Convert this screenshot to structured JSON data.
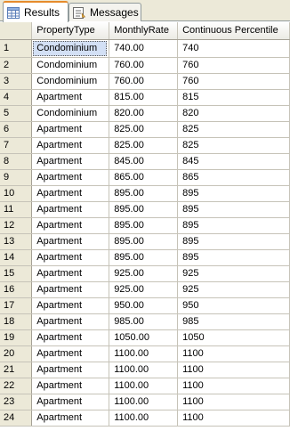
{
  "tabs": [
    {
      "label": "Results",
      "icon": "grid-icon"
    },
    {
      "label": "Messages",
      "icon": "messages-icon"
    }
  ],
  "columns": [
    "",
    "PropertyType",
    "MonthlyRate",
    "Continuous Percentile"
  ],
  "rows": [
    {
      "n": "1",
      "type": "Condominium",
      "rate": "740.00",
      "pct": "740"
    },
    {
      "n": "2",
      "type": "Condominium",
      "rate": "760.00",
      "pct": "760"
    },
    {
      "n": "3",
      "type": "Condominium",
      "rate": "760.00",
      "pct": "760"
    },
    {
      "n": "4",
      "type": "Apartment",
      "rate": "815.00",
      "pct": "815"
    },
    {
      "n": "5",
      "type": "Condominium",
      "rate": "820.00",
      "pct": "820"
    },
    {
      "n": "6",
      "type": "Apartment",
      "rate": "825.00",
      "pct": "825"
    },
    {
      "n": "7",
      "type": "Apartment",
      "rate": "825.00",
      "pct": "825"
    },
    {
      "n": "8",
      "type": "Apartment",
      "rate": "845.00",
      "pct": "845"
    },
    {
      "n": "9",
      "type": "Apartment",
      "rate": "865.00",
      "pct": "865"
    },
    {
      "n": "10",
      "type": "Apartment",
      "rate": "895.00",
      "pct": "895"
    },
    {
      "n": "11",
      "type": "Apartment",
      "rate": "895.00",
      "pct": "895"
    },
    {
      "n": "12",
      "type": "Apartment",
      "rate": "895.00",
      "pct": "895"
    },
    {
      "n": "13",
      "type": "Apartment",
      "rate": "895.00",
      "pct": "895"
    },
    {
      "n": "14",
      "type": "Apartment",
      "rate": "895.00",
      "pct": "895"
    },
    {
      "n": "15",
      "type": "Apartment",
      "rate": "925.00",
      "pct": "925"
    },
    {
      "n": "16",
      "type": "Apartment",
      "rate": "925.00",
      "pct": "925"
    },
    {
      "n": "17",
      "type": "Apartment",
      "rate": "950.00",
      "pct": "950"
    },
    {
      "n": "18",
      "type": "Apartment",
      "rate": "985.00",
      "pct": "985"
    },
    {
      "n": "19",
      "type": "Apartment",
      "rate": "1050.00",
      "pct": "1050"
    },
    {
      "n": "20",
      "type": "Apartment",
      "rate": "1100.00",
      "pct": "1100"
    },
    {
      "n": "21",
      "type": "Apartment",
      "rate": "1100.00",
      "pct": "1100"
    },
    {
      "n": "22",
      "type": "Apartment",
      "rate": "1100.00",
      "pct": "1100"
    },
    {
      "n": "23",
      "type": "Apartment",
      "rate": "1100.00",
      "pct": "1100"
    },
    {
      "n": "24",
      "type": "Apartment",
      "rate": "1100.00",
      "pct": "1100"
    }
  ],
  "selected_cell": {
    "row": 0,
    "column": "PropertyType"
  },
  "colors": {
    "selection": "#d3e0f5",
    "active_tab_accent": "#e68b2c",
    "header_bg": "#ece9d8"
  }
}
